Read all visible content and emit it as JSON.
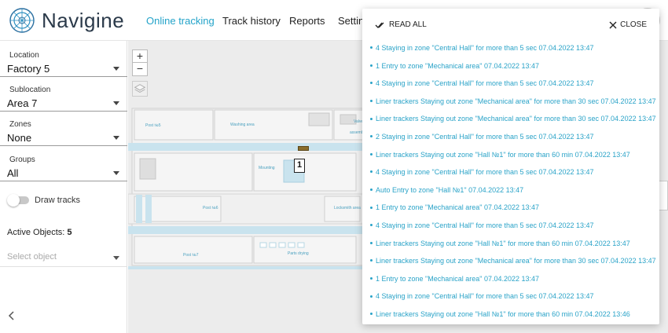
{
  "header": {
    "brand": "Navigine",
    "nav": [
      {
        "label": "Online tracking",
        "active": true
      },
      {
        "label": "Track history",
        "active": false
      },
      {
        "label": "Reports",
        "active": false
      },
      {
        "label": "Setting",
        "active": false
      }
    ]
  },
  "sidebar": {
    "location": {
      "label": "Location",
      "value": "Factory 5"
    },
    "sublocation": {
      "label": "Sublocation",
      "value": "Area 7"
    },
    "zones": {
      "label": "Zones",
      "value": "None"
    },
    "groups": {
      "label": "Groups",
      "value": "All"
    },
    "draw_tracks": "Draw tracks",
    "active_objects_label": "Active Objects:",
    "active_objects_count": "5",
    "select_object_placeholder": "Select object",
    "collapse_icon": "chevron-left-icon"
  },
  "map": {
    "zoom_in": "+",
    "zoom_out": "−",
    "labels": {
      "post5": "Post №5",
      "washing": "Washing area",
      "valve": "Valve",
      "assembly": "assembl...",
      "mounting": "Mounting",
      "post6": "Post №6",
      "locksmith": "Locksmith area",
      "post7": "Post №7",
      "parts_drying": "Parts drying"
    },
    "marker_number": "1"
  },
  "notifications": {
    "read_all": "READ ALL",
    "close": "CLOSE",
    "items": [
      "4 Staying in zone \"Central Hall\" for more than 5 sec 07.04.2022 13:47",
      "1 Entry to zone \"Mechanical area\" 07.04.2022 13:47",
      "4 Staying in zone \"Central Hall\" for more than 5 sec 07.04.2022 13:47",
      "Liner trackers Staying out zone \"Mechanical area\" for more than 30 sec 07.04.2022 13:47",
      "Liner trackers Staying out zone \"Mechanical area\" for more than 30 sec 07.04.2022 13:47",
      "2 Staying in zone \"Central Hall\" for more than 5 sec 07.04.2022 13:47",
      "Liner trackers Staying out zone \"Hall №1\" for more than 60 min 07.04.2022 13:47",
      "4 Staying in zone \"Central Hall\" for more than 5 sec 07.04.2022 13:47",
      "Auto Entry to zone \"Hall №1\" 07.04.2022 13:47",
      "1 Entry to zone \"Mechanical area\" 07.04.2022 13:47",
      "4 Staying in zone \"Central Hall\" for more than 5 sec 07.04.2022 13:47",
      "Liner trackers Staying out zone \"Hall №1\" for more than 60 min 07.04.2022 13:47",
      "Liner trackers Staying out zone \"Mechanical area\" for more than 30 sec 07.04.2022 13:47",
      "1 Entry to zone \"Mechanical area\" 07.04.2022 13:47",
      "4 Staying in zone \"Central Hall\" for more than 5 sec 07.04.2022 13:47",
      "Liner trackers Staying out zone \"Hall №1\" for more than 60 min 07.04.2022 13:46"
    ]
  },
  "colors": {
    "accent": "#23a3c9",
    "notification_text": "#2aa3c8",
    "brand_text": "#2b3a4a",
    "map_background": "#ececec"
  }
}
